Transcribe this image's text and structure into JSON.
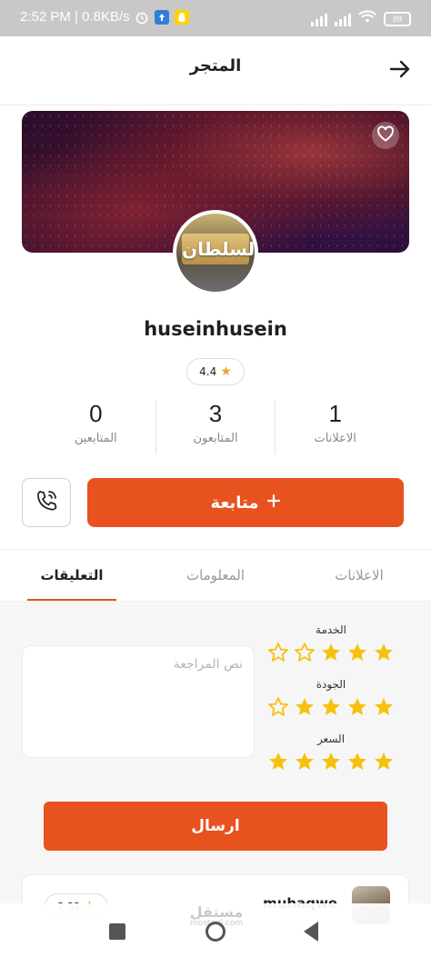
{
  "status_bar": {
    "time": "2:52 PM | 0.8KB/s",
    "battery": "88"
  },
  "header": {
    "title": "المتجر",
    "back_icon": "arrow-right-icon"
  },
  "store": {
    "cover_icon": "heart-outline-icon",
    "avatar_sign_text": "السلطان",
    "username": "huseinhusein",
    "rating": "4.4"
  },
  "stats": [
    {
      "value": "1",
      "label": "الاعلانات"
    },
    {
      "value": "3",
      "label": "المتابعون"
    },
    {
      "value": "0",
      "label": "المتابعين"
    }
  ],
  "actions": {
    "follow_label": "متابعة",
    "follow_icon": "plus-icon",
    "call_icon": "phone-icon"
  },
  "tabs": [
    {
      "label": "الاعلانات",
      "active": false
    },
    {
      "label": "المعلومات",
      "active": false
    },
    {
      "label": "التعليقات",
      "active": true
    }
  ],
  "review_form": {
    "criteria": [
      {
        "label": "الخدمة",
        "filled": 3,
        "total": 5
      },
      {
        "label": "الجودة",
        "filled": 4,
        "total": 5
      },
      {
        "label": "السعر",
        "filled": 5,
        "total": 5
      }
    ],
    "placeholder": "نص المراجعة",
    "submit_label": "ارسال"
  },
  "comments": [
    {
      "name": "muhaqwe",
      "rating": "2.33"
    }
  ],
  "watermark": {
    "text": "مستقل",
    "sub": "mostaql.com"
  },
  "colors": {
    "accent": "#e8521e",
    "star": "#f6c10e"
  }
}
